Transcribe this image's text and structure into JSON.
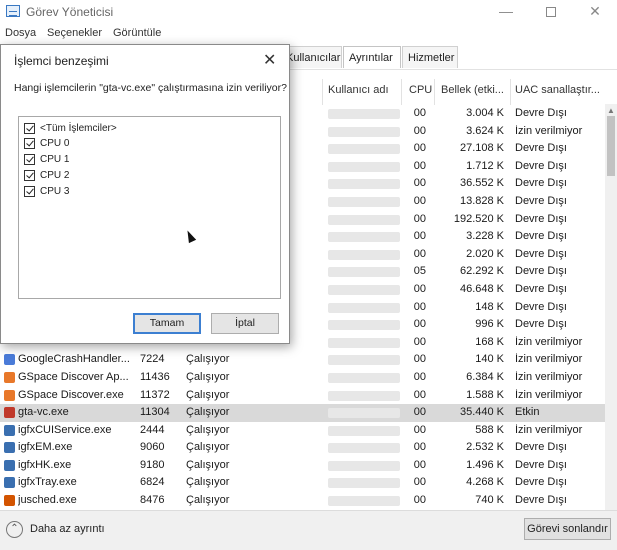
{
  "window": {
    "title": "Görev Yöneticisi"
  },
  "menu": [
    "Dosya",
    "Seçenekler",
    "Görüntüle"
  ],
  "tabs": [
    {
      "label": "Kullanıcılar",
      "active": false
    },
    {
      "label": "Ayrıntılar",
      "active": true
    },
    {
      "label": "Hizmetler",
      "active": false
    }
  ],
  "columns": {
    "user": "Kullanıcı adı",
    "cpu": "CPU",
    "memory": "Bellek (etki...",
    "uac": "UAC sanallaştır..."
  },
  "rows": [
    {
      "name": "",
      "pid": "",
      "status": "",
      "cpu": "00",
      "memory": "3.004 K",
      "uac": "Devre Dışı",
      "icon": "blank",
      "selected": false
    },
    {
      "name": "",
      "pid": "",
      "status": "",
      "cpu": "00",
      "memory": "3.624 K",
      "uac": "İzin verilmiyor",
      "icon": "blank",
      "selected": false
    },
    {
      "name": "",
      "pid": "",
      "status": "",
      "cpu": "00",
      "memory": "27.108 K",
      "uac": "Devre Dışı",
      "icon": "blank",
      "selected": false
    },
    {
      "name": "",
      "pid": "",
      "status": "",
      "cpu": "00",
      "memory": "1.712 K",
      "uac": "Devre Dışı",
      "icon": "blank",
      "selected": false
    },
    {
      "name": "",
      "pid": "",
      "status": "",
      "cpu": "00",
      "memory": "36.552 K",
      "uac": "Devre Dışı",
      "icon": "blank",
      "selected": false
    },
    {
      "name": "",
      "pid": "",
      "status": "",
      "cpu": "00",
      "memory": "13.828 K",
      "uac": "Devre Dışı",
      "icon": "blank",
      "selected": false
    },
    {
      "name": "",
      "pid": "",
      "status": "",
      "cpu": "00",
      "memory": "192.520 K",
      "uac": "Devre Dışı",
      "icon": "blank",
      "selected": false
    },
    {
      "name": "",
      "pid": "",
      "status": "",
      "cpu": "00",
      "memory": "3.228 K",
      "uac": "Devre Dışı",
      "icon": "blank",
      "selected": false
    },
    {
      "name": "",
      "pid": "",
      "status": "",
      "cpu": "00",
      "memory": "2.020 K",
      "uac": "Devre Dışı",
      "icon": "blank",
      "selected": false
    },
    {
      "name": "",
      "pid": "",
      "status": "",
      "cpu": "05",
      "memory": "62.292 K",
      "uac": "Devre Dışı",
      "icon": "blank",
      "selected": false
    },
    {
      "name": "",
      "pid": "",
      "status": "",
      "cpu": "00",
      "memory": "46.648 K",
      "uac": "Devre Dışı",
      "icon": "blank",
      "selected": false
    },
    {
      "name": "",
      "pid": "",
      "status": "",
      "cpu": "00",
      "memory": "148 K",
      "uac": "Devre Dışı",
      "icon": "blank",
      "selected": false
    },
    {
      "name": "",
      "pid": "",
      "status": "",
      "cpu": "00",
      "memory": "996 K",
      "uac": "Devre Dışı",
      "icon": "blank",
      "selected": false
    },
    {
      "name": "",
      "pid": "",
      "status": "",
      "cpu": "00",
      "memory": "168 K",
      "uac": "İzin verilmiyor",
      "icon": "blank",
      "selected": false
    },
    {
      "name": "GoogleCrashHandler...",
      "pid": "7224",
      "status": "Çalışıyor",
      "cpu": "00",
      "memory": "140 K",
      "uac": "İzin verilmiyor",
      "icon": "google",
      "selected": false
    },
    {
      "name": "GSpace Discover Ap...",
      "pid": "11436",
      "status": "Çalışıyor",
      "cpu": "00",
      "memory": "6.384 K",
      "uac": "İzin verilmiyor",
      "icon": "gspace",
      "selected": false
    },
    {
      "name": "GSpace Discover.exe",
      "pid": "11372",
      "status": "Çalışıyor",
      "cpu": "00",
      "memory": "1.588 K",
      "uac": "İzin verilmiyor",
      "icon": "gspace",
      "selected": false
    },
    {
      "name": "gta-vc.exe",
      "pid": "11304",
      "status": "Çalışıyor",
      "cpu": "00",
      "memory": "35.440 K",
      "uac": "Etkin",
      "icon": "gta",
      "selected": true
    },
    {
      "name": "igfxCUIService.exe",
      "pid": "2444",
      "status": "Çalışıyor",
      "cpu": "00",
      "memory": "588 K",
      "uac": "İzin verilmiyor",
      "icon": "app",
      "selected": false
    },
    {
      "name": "igfxEM.exe",
      "pid": "9060",
      "status": "Çalışıyor",
      "cpu": "00",
      "memory": "2.532 K",
      "uac": "Devre Dışı",
      "icon": "app",
      "selected": false
    },
    {
      "name": "igfxHK.exe",
      "pid": "9180",
      "status": "Çalışıyor",
      "cpu": "00",
      "memory": "1.496 K",
      "uac": "Devre Dışı",
      "icon": "app",
      "selected": false
    },
    {
      "name": "igfxTray.exe",
      "pid": "6824",
      "status": "Çalışıyor",
      "cpu": "00",
      "memory": "4.268 K",
      "uac": "Devre Dışı",
      "icon": "app",
      "selected": false
    },
    {
      "name": "jusched.exe",
      "pid": "8476",
      "status": "Çalışıyor",
      "cpu": "00",
      "memory": "740 K",
      "uac": "Devre Dışı",
      "icon": "java",
      "selected": false
    }
  ],
  "icon_colors": {
    "google": "#4a7bd8",
    "gspace": "#e8782a",
    "gta": "#c0392b",
    "app": "#3a6fb0",
    "java": "#d35400",
    "blank": "#ffffff"
  },
  "footer": {
    "less_details": "Daha az ayrıntı",
    "end_task": "Görevi sonlandır"
  },
  "dialog": {
    "title": "İşlemci benzeşimi",
    "question": "Hangi işlemcilerin \"gta-vc.exe\" çalıştırmasına izin veriliyor?",
    "options": [
      "<Tüm İşlemciler>",
      "CPU 0",
      "CPU 1",
      "CPU 2",
      "CPU 3"
    ],
    "ok": "Tamam",
    "cancel": "İptal"
  }
}
